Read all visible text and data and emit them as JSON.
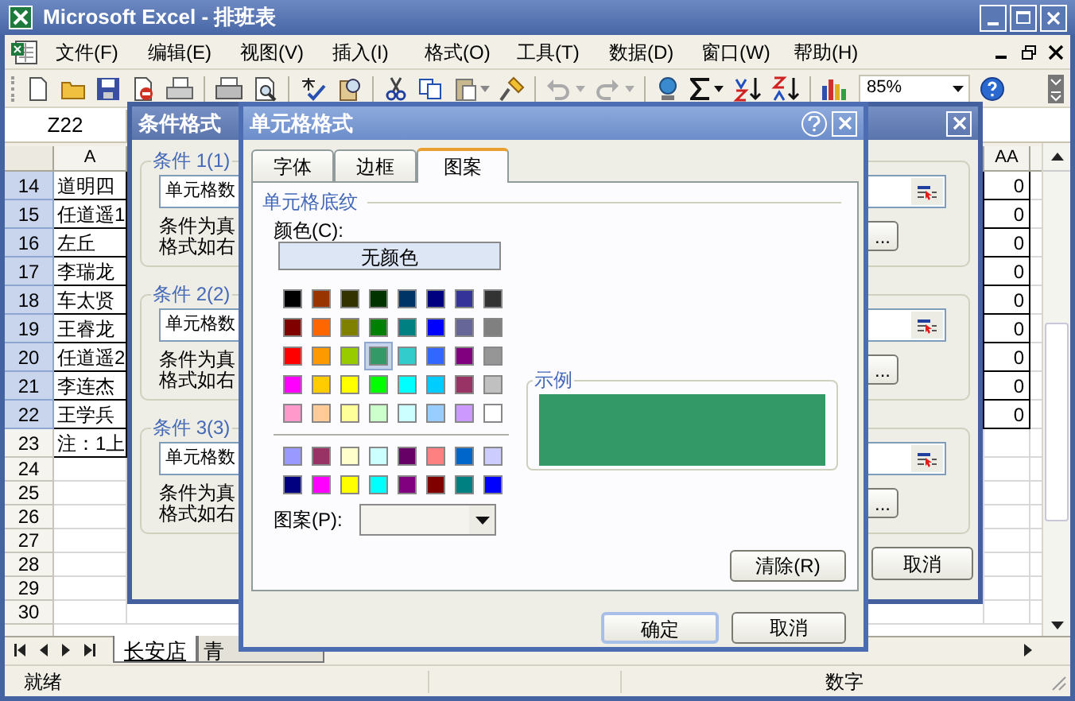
{
  "window": {
    "title": "Microsoft Excel - 排班表"
  },
  "menu": [
    {
      "label": "文件(F)"
    },
    {
      "label": "编辑(E)"
    },
    {
      "label": "视图(V)"
    },
    {
      "label": "插入(I)"
    },
    {
      "label": "格式(O)"
    },
    {
      "label": "工具(T)"
    },
    {
      "label": "数据(D)"
    },
    {
      "label": "窗口(W)"
    },
    {
      "label": "帮助(H)"
    }
  ],
  "toolbar": {
    "zoom": "85%"
  },
  "name_box": "Z22",
  "columns": [
    "A",
    "AA"
  ],
  "rows": [
    {
      "number": "14",
      "selected": true,
      "cells": [
        "道明四",
        "0"
      ]
    },
    {
      "number": "15",
      "selected": true,
      "cells": [
        "任道遥1",
        "0"
      ]
    },
    {
      "number": "16",
      "selected": true,
      "cells": [
        "左丘",
        "0"
      ]
    },
    {
      "number": "17",
      "selected": true,
      "cells": [
        "李瑞龙",
        "0"
      ]
    },
    {
      "number": "18",
      "selected": true,
      "cells": [
        "车太贤",
        "0"
      ]
    },
    {
      "number": "19",
      "selected": true,
      "cells": [
        "王睿龙",
        "0"
      ]
    },
    {
      "number": "20",
      "selected": true,
      "cells": [
        "任道遥2",
        "0"
      ]
    },
    {
      "number": "21",
      "selected": true,
      "cells": [
        "李连杰",
        "0"
      ]
    },
    {
      "number": "22",
      "selected": true,
      "cells": [
        "王学兵",
        "0"
      ]
    },
    {
      "number": "23",
      "selected": false,
      "cells": [
        "注：1上"
      ]
    },
    {
      "number": "24",
      "selected": false
    },
    {
      "number": "25",
      "selected": false
    },
    {
      "number": "26",
      "selected": false
    },
    {
      "number": "27",
      "selected": false
    },
    {
      "number": "28",
      "selected": false
    },
    {
      "number": "29",
      "selected": false
    },
    {
      "number": "30",
      "selected": false
    }
  ],
  "sheet_tabs": [
    {
      "label": "长安店",
      "selected": true
    },
    {
      "label": "青",
      "selected": false
    }
  ],
  "status_bar": {
    "ready": "就绪",
    "mode": "数字"
  },
  "conditional_format_dialog": {
    "title": "条件格式",
    "conditions": [
      {
        "label": "条件 1(1)",
        "operator_field": "单元格数",
        "description": [
          "条件为真",
          "格式如右"
        ],
        "format_button": "..."
      },
      {
        "label": "条件 2(2)",
        "operator_field": "单元格数",
        "description": [
          "条件为真",
          "格式如右"
        ],
        "format_button": "..."
      },
      {
        "label": "条件 3(3)",
        "operator_field": "单元格数",
        "description": [
          "条件为真",
          "格式如右"
        ],
        "format_button": "..."
      }
    ],
    "cancel_button": "取消"
  },
  "format_cells_dialog": {
    "title": "单元格格式",
    "tabs": [
      {
        "label": "字体",
        "selected": false
      },
      {
        "label": "边框",
        "selected": false
      },
      {
        "label": "图案",
        "selected": true
      }
    ],
    "shading_label": "单元格底纹",
    "color_label": "颜色(C):",
    "no_color_button": "无颜色",
    "palette": [
      {
        "color": "#000000",
        "selected": false
      },
      {
        "color": "#993300",
        "selected": false
      },
      {
        "color": "#333300",
        "selected": false
      },
      {
        "color": "#003300",
        "selected": false
      },
      {
        "color": "#003366",
        "selected": false
      },
      {
        "color": "#000080",
        "selected": false
      },
      {
        "color": "#333399",
        "selected": false
      },
      {
        "color": "#333333",
        "selected": false
      },
      {
        "color": "#800000",
        "selected": false
      },
      {
        "color": "#ff6600",
        "selected": false
      },
      {
        "color": "#808000",
        "selected": false
      },
      {
        "color": "#008000",
        "selected": false
      },
      {
        "color": "#008080",
        "selected": false
      },
      {
        "color": "#0000ff",
        "selected": false
      },
      {
        "color": "#666699",
        "selected": false
      },
      {
        "color": "#808080",
        "selected": false
      },
      {
        "color": "#ff0000",
        "selected": false
      },
      {
        "color": "#ff9900",
        "selected": false
      },
      {
        "color": "#99cc00",
        "selected": false
      },
      {
        "color": "#339966",
        "selected": true
      },
      {
        "color": "#33cccc",
        "selected": false
      },
      {
        "color": "#3366ff",
        "selected": false
      },
      {
        "color": "#800080",
        "selected": false
      },
      {
        "color": "#969696",
        "selected": false
      },
      {
        "color": "#ff00ff",
        "selected": false
      },
      {
        "color": "#ffcc00",
        "selected": false
      },
      {
        "color": "#ffff00",
        "selected": false
      },
      {
        "color": "#00ff00",
        "selected": false
      },
      {
        "color": "#00ffff",
        "selected": false
      },
      {
        "color": "#00ccff",
        "selected": false
      },
      {
        "color": "#993366",
        "selected": false
      },
      {
        "color": "#c0c0c0",
        "selected": false
      },
      {
        "color": "#ff99cc",
        "selected": false
      },
      {
        "color": "#ffcc99",
        "selected": false
      },
      {
        "color": "#ffff99",
        "selected": false
      },
      {
        "color": "#ccffcc",
        "selected": false
      },
      {
        "color": "#ccffff",
        "selected": false
      },
      {
        "color": "#99ccff",
        "selected": false
      },
      {
        "color": "#cc99ff",
        "selected": false
      },
      {
        "color": "#ffffff",
        "selected": false
      }
    ],
    "chart_palette": [
      {
        "color": "#9999ff",
        "selected": false
      },
      {
        "color": "#993366",
        "selected": false
      },
      {
        "color": "#ffffcc",
        "selected": false
      },
      {
        "color": "#ccffff",
        "selected": false
      },
      {
        "color": "#660066",
        "selected": false
      },
      {
        "color": "#ff8080",
        "selected": false
      },
      {
        "color": "#0066cc",
        "selected": false
      },
      {
        "color": "#ccccff",
        "selected": false
      },
      {
        "color": "#000080",
        "selected": false
      },
      {
        "color": "#ff00ff",
        "selected": false
      },
      {
        "color": "#ffff00",
        "selected": false
      },
      {
        "color": "#00ffff",
        "selected": false
      },
      {
        "color": "#800080",
        "selected": false
      },
      {
        "color": "#800000",
        "selected": false
      },
      {
        "color": "#008080",
        "selected": false
      },
      {
        "color": "#0000ff",
        "selected": false
      }
    ],
    "pattern_label": "图案(P):",
    "sample_label": "示例",
    "clear_button": "清除(R)",
    "ok_button": "确定",
    "cancel_button": "取消"
  }
}
